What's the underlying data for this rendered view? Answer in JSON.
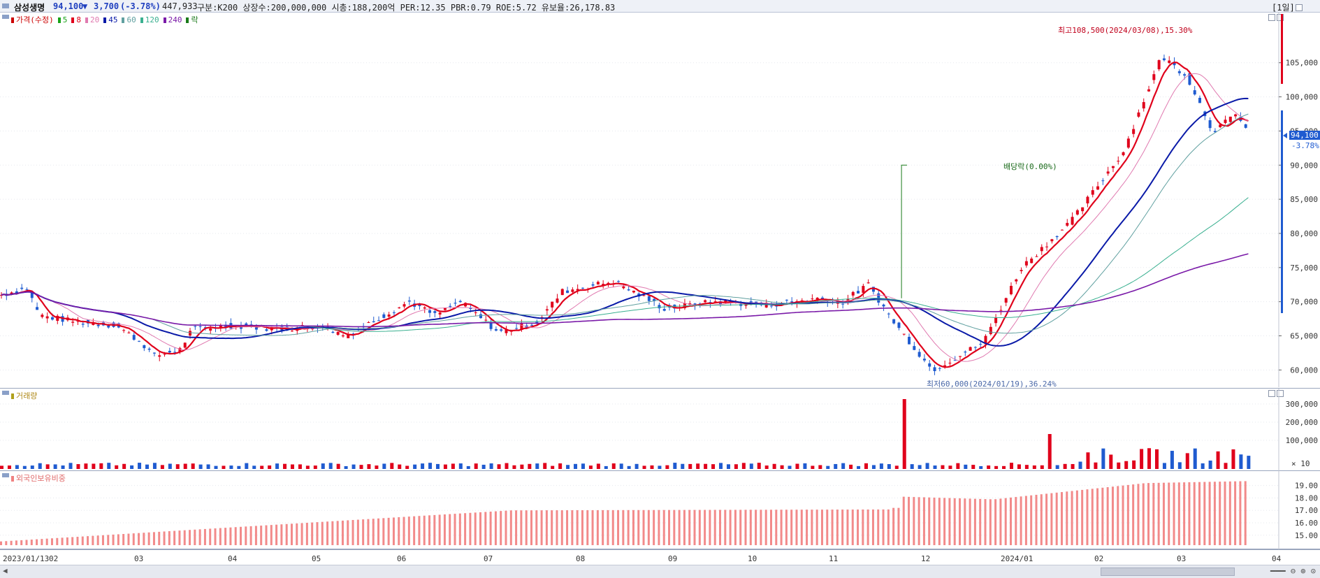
{
  "header": {
    "name": "삼성생명",
    "price": "94,100",
    "down_arrow": "▼",
    "change": "3,700",
    "change_pct": "(-3.78%)",
    "volume": "447,933",
    "info": "구분:K200 상장수:200,000,000 시총:188,200억 PER:12.35 PBR:0.79 ROE:5.72 유보율:26,178.83",
    "period_btn": "[1일]"
  },
  "price_pane": {
    "legend": [
      {
        "label": "가격(수정)",
        "color": "#cc0000"
      },
      {
        "label": "5",
        "color": "#1aa31a"
      },
      {
        "label": "8",
        "color": "#e0001b"
      },
      {
        "label": "20",
        "color": "#e07ab0"
      },
      {
        "label": "45",
        "color": "#0a1aa8"
      },
      {
        "label": "60",
        "color": "#60a0a0"
      },
      {
        "label": "120",
        "color": "#3ab090"
      },
      {
        "label": "240",
        "color": "#7a1aa8"
      },
      {
        "label": "락",
        "color": "#1a7a1a"
      }
    ],
    "y_ticks": [
      "105,000",
      "100,000",
      "95,000",
      "90,000",
      "85,000",
      "80,000",
      "75,000",
      "70,000",
      "65,000",
      "60,000"
    ],
    "y_values": [
      105000,
      100000,
      95000,
      90000,
      85000,
      80000,
      75000,
      70000,
      65000,
      60000
    ],
    "current_label": "94,100",
    "current_pct": "-3.78%",
    "annotation_high": "최고108,500(2024/03/08),15.30%",
    "annotation_low": "최저60,000(2024/01/19),36.24%",
    "annotation_div": "배당락(0.00%)"
  },
  "volume_pane": {
    "title": "거래량",
    "y_ticks": [
      "300,000",
      "200,000",
      "100,000"
    ],
    "multiplier": "× 10"
  },
  "foreign_pane": {
    "title": "외국인보유비중",
    "y_ticks": [
      "19.00",
      "18.00",
      "17.00",
      "16.00",
      "15.00"
    ]
  },
  "x_axis": {
    "labels": [
      "2023/01/13",
      "02",
      "03",
      "04",
      "05",
      "06",
      "07",
      "08",
      "09",
      "10",
      "11",
      "12",
      "2024/01",
      "02",
      "03",
      "04"
    ]
  },
  "colors": {
    "up": "#e0001b",
    "down": "#1f5bd0",
    "accent": "#cc0000"
  }
}
